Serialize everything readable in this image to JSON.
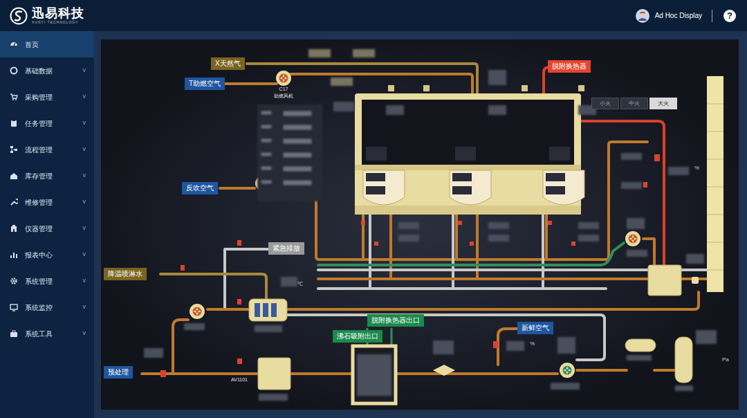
{
  "header": {
    "brand": "迅易科技",
    "brand_sub": "XUNYI TECHNOLOGY",
    "user": "Ad Hoc Display",
    "help": "?"
  },
  "sidebar": {
    "items": [
      {
        "label": "首页",
        "selected": true
      },
      {
        "label": "基础数据",
        "selected": false,
        "chevron": "v"
      },
      {
        "label": "采购管理",
        "selected": false,
        "chevron": "v"
      },
      {
        "label": "任务管理",
        "selected": false,
        "chevron": "v"
      },
      {
        "label": "流程管理",
        "selected": false,
        "chevron": "v"
      },
      {
        "label": "库存管理",
        "selected": false,
        "chevron": "v"
      },
      {
        "label": "维修管理",
        "selected": false,
        "chevron": "v"
      },
      {
        "label": "仪器管理",
        "selected": false,
        "chevron": "v"
      },
      {
        "label": "报表中心",
        "selected": false,
        "chevron": "v"
      },
      {
        "label": "系统管理",
        "selected": false,
        "chevron": "v"
      },
      {
        "label": "系统监控",
        "selected": false,
        "chevron": "v"
      },
      {
        "label": "系统工具",
        "selected": false,
        "chevron": "v"
      }
    ]
  },
  "diagram": {
    "labels": [
      {
        "text": "X天然气",
        "color": "#7a6520"
      },
      {
        "text": "T助燃空气",
        "color": "#1e56a0"
      },
      {
        "text": "脱附换热器",
        "color": "#e5452e"
      },
      {
        "text": "反吹空气",
        "color": "#1e56a0"
      },
      {
        "text": "紧急排放",
        "color": "#9a9a9a"
      },
      {
        "text": "降温喷淋水",
        "color": "#7a6520"
      },
      {
        "text": "预处理",
        "color": "#1e56a0"
      },
      {
        "text": "脱附换热器出口",
        "color": "#1c8a4c"
      },
      {
        "text": "沸石吸附出口",
        "color": "#1c8a4c"
      },
      {
        "text": "新鲜空气",
        "color": "#1e56a0"
      }
    ],
    "captions": [
      {
        "text": "C17"
      },
      {
        "text": "助燃风机"
      },
      {
        "text": "AV1101"
      }
    ],
    "units": [
      {
        "text": "℃"
      },
      {
        "text": "%"
      },
      {
        "text": "%"
      },
      {
        "text": "Pa"
      }
    ],
    "fire_modes": [
      {
        "label": "小火",
        "selected": false
      },
      {
        "label": "中火",
        "selected": false
      },
      {
        "label": "大火",
        "selected": true
      }
    ]
  }
}
